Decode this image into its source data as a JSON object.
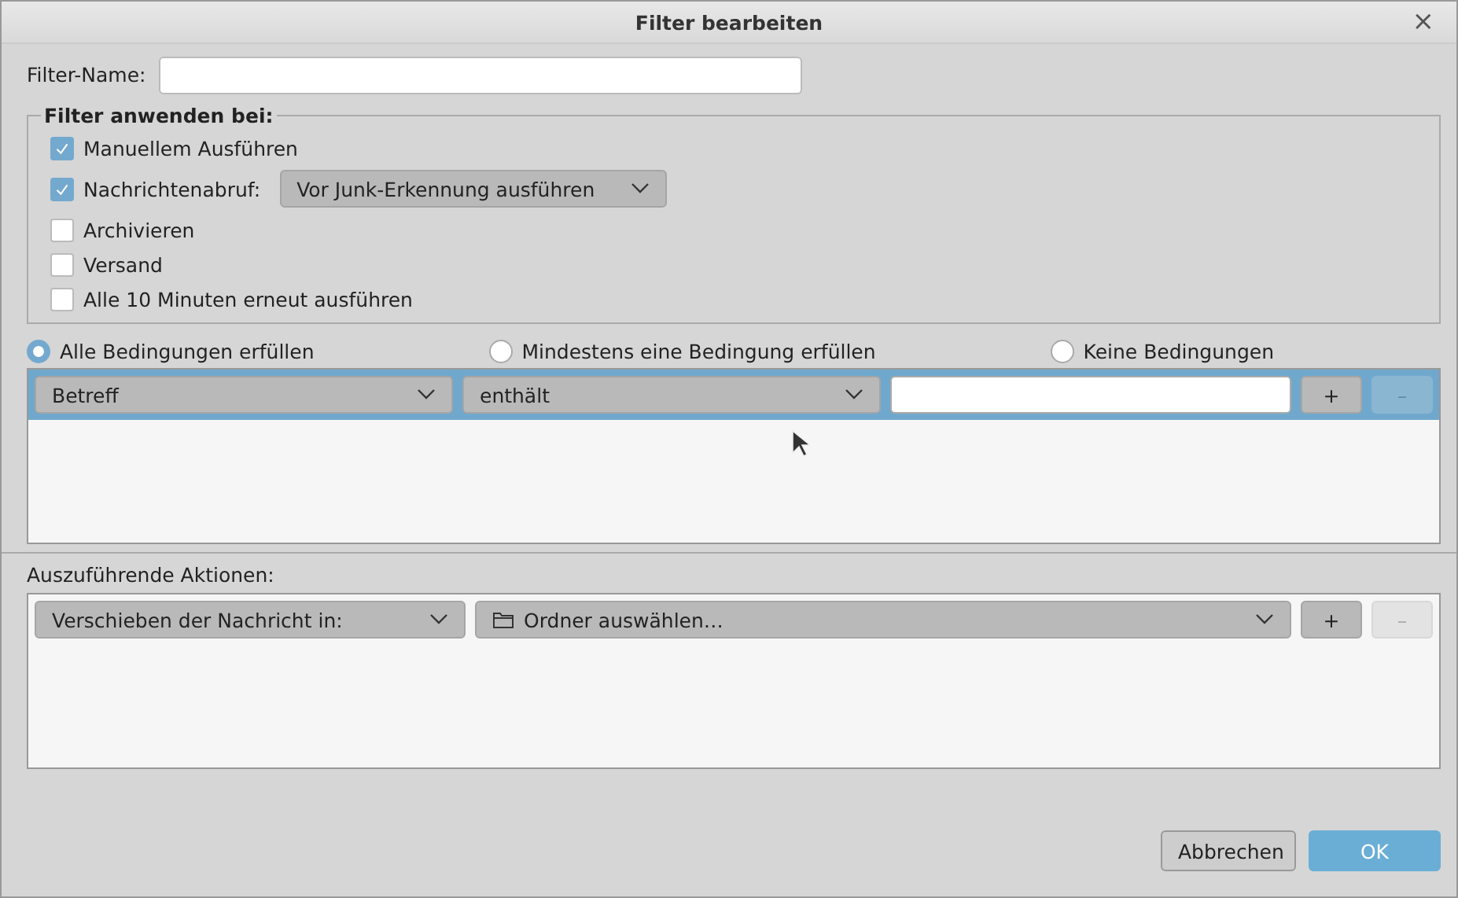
{
  "window": {
    "title": "Filter bearbeiten",
    "close": "×"
  },
  "filter_name": {
    "label": "Filter-Name:"
  },
  "apply_group": {
    "title": "Filter anwenden bei:",
    "options": [
      {
        "label": "Manuellem Ausführen",
        "checked": true
      },
      {
        "label": "Nachrichtenabruf:",
        "checked": true,
        "dropdown": "Vor Junk-Erkennung ausführen"
      },
      {
        "label": "Archivieren",
        "checked": false
      },
      {
        "label": "Versand",
        "checked": false
      },
      {
        "label": "Alle 10 Minuten erneut ausführen",
        "checked": false
      }
    ]
  },
  "match_mode": [
    {
      "label": "Alle Bedingungen erfüllen",
      "selected": true
    },
    {
      "label": "Mindestens eine Bedingung erfüllen",
      "selected": false
    },
    {
      "label": "Keine Bedingungen",
      "selected": false
    }
  ],
  "conditions": [
    {
      "selected": true,
      "field": "Betreff",
      "operator": "enthält",
      "add": {
        "label": "+",
        "disabled": false
      },
      "remove": {
        "label": "–",
        "disabled": true
      }
    }
  ],
  "actions_label": "Auszuführende Aktionen:",
  "actions": [
    {
      "selected": false,
      "action": "Verschieben der Nachricht in:",
      "target": "Ordner auswählen…",
      "add": {
        "label": "+",
        "disabled": false
      },
      "remove": {
        "label": "–",
        "disabled": true
      }
    }
  ],
  "buttons": [
    {
      "label": "Abbrechen",
      "kind": "secondary"
    },
    {
      "label": "OK",
      "kind": "primary"
    }
  ]
}
